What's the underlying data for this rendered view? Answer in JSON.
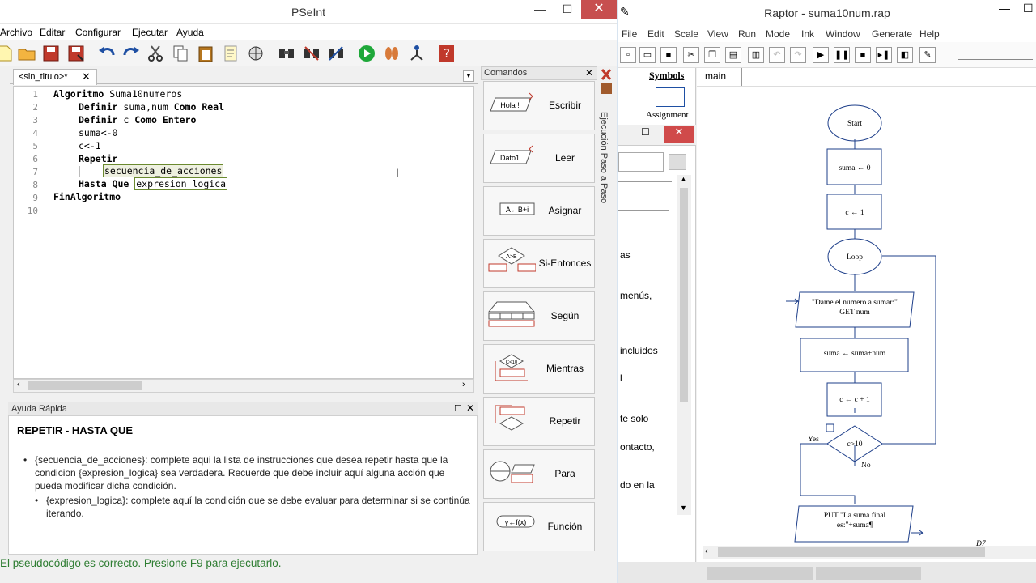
{
  "pseint": {
    "title": "PSeInt",
    "window_buttons": {
      "minimize": "—",
      "maximize": "☐",
      "close": "✕"
    },
    "menu": [
      "Archivo",
      "Editar",
      "Configurar",
      "Ejecutar",
      "Ayuda"
    ],
    "toolbar_icons": [
      "new-file-icon",
      "open-folder-icon",
      "save-icon",
      "save-as-icon",
      "undo-icon",
      "redo-icon",
      "cut-icon",
      "copy-icon",
      "paste-icon",
      "comment-icon",
      "debug-icon",
      "find-icon",
      "find-replace-icon",
      "indent-icon",
      "run-icon",
      "step-icon",
      "flowchart-icon",
      "help-icon"
    ],
    "editor_tab": "<sin_titulo>*",
    "code_lines": [
      {
        "num": "1",
        "text": "Algoritmo Suma10numeros"
      },
      {
        "num": "2",
        "text": "Definir suma,num Como Real"
      },
      {
        "num": "3",
        "text": "Definir c Como Entero"
      },
      {
        "num": "4",
        "text": "suma<-0"
      },
      {
        "num": "5",
        "text": "c<-1"
      },
      {
        "num": "6",
        "text": "Repetir"
      },
      {
        "num": "7",
        "text": "secuencia_de_acciones"
      },
      {
        "num": "8",
        "text": "Hasta Que expresion_logica"
      },
      {
        "num": "9",
        "text": "FinAlgoritmo"
      },
      {
        "num": "10",
        "text": ""
      }
    ],
    "code": {
      "l1_kw": "Algoritmo",
      "l1_name": " Suma10numeros",
      "l2_kw1": "Definir",
      "l2_vars": " suma,num ",
      "l2_kw2": "Como Real",
      "l3_kw1": "Definir",
      "l3_vars": " c ",
      "l3_kw2": "Como Entero",
      "l4": "suma<-0",
      "l5": "c<-1",
      "l6": "Repetir",
      "l7_ph": "secuencia_de_acciones",
      "l8_kw": "Hasta Que ",
      "l8_ph": "expresion_logica",
      "l9": "FinAlgoritmo"
    },
    "help": {
      "header": "Ayuda Rápida",
      "title": "REPETIR - HASTA QUE",
      "bullets": [
        "{secuencia_de_acciones}: complete aqui la lista de instrucciones que desea repetir hasta que la condicion {expresion_logica} sea verdadera. Recuerde que debe incluir aquí alguna acción que pueda modificar dicha condición.",
        "{expresion_logica}: complete aquí la condición que se debe evaluar para determinar si se continúa iterando."
      ]
    },
    "status": "El pseudocódigo es correcto. Presione F9 para ejecutarlo.",
    "commands_header": "Comandos",
    "commands": [
      {
        "label": "Escribir",
        "icon_text": "Hola !"
      },
      {
        "label": "Leer",
        "icon_text": "Dato1"
      },
      {
        "label": "Asignar",
        "icon_text": "A←B+i"
      },
      {
        "label": "Si-Entonces",
        "icon_text": "A>B"
      },
      {
        "label": "Según",
        "icon_text": ""
      },
      {
        "label": "Mientras",
        "icon_text": "C<10"
      },
      {
        "label": "Repetir",
        "icon_text": ""
      },
      {
        "label": "Para",
        "icon_text": ""
      },
      {
        "label": "Función",
        "icon_text": "y←f(x)"
      }
    ],
    "side_label": "Ejecución Paso a Paso"
  },
  "raptor": {
    "title": "Raptor - suma10num.rap",
    "menu": [
      "File",
      "Edit",
      "Scale",
      "View",
      "Run",
      "Mode",
      "Ink",
      "Window",
      "Generate",
      "Help"
    ],
    "symbols_label": "Symbols",
    "assignment_label": "Assignment",
    "main_tab": "main",
    "partial_text": [
      "as",
      "menús,",
      "incluidos",
      "l",
      "te solo",
      "ontacto,",
      "do en la"
    ],
    "flowchart": {
      "start": "Start",
      "assign1": "suma ← 0",
      "assign2": "c ← 1",
      "loop": "Loop",
      "input_prompt": "\"Dame el numero a sumar:\"",
      "input_var": "GET num",
      "assign3": "suma ← suma+num",
      "assign4": "c ← c + 1",
      "condition": "c>10",
      "yes": "Yes",
      "no": "No",
      "output1": "PUT \"La suma final",
      "output2": "es:\"+suma¶"
    },
    "watermark": "D7"
  }
}
